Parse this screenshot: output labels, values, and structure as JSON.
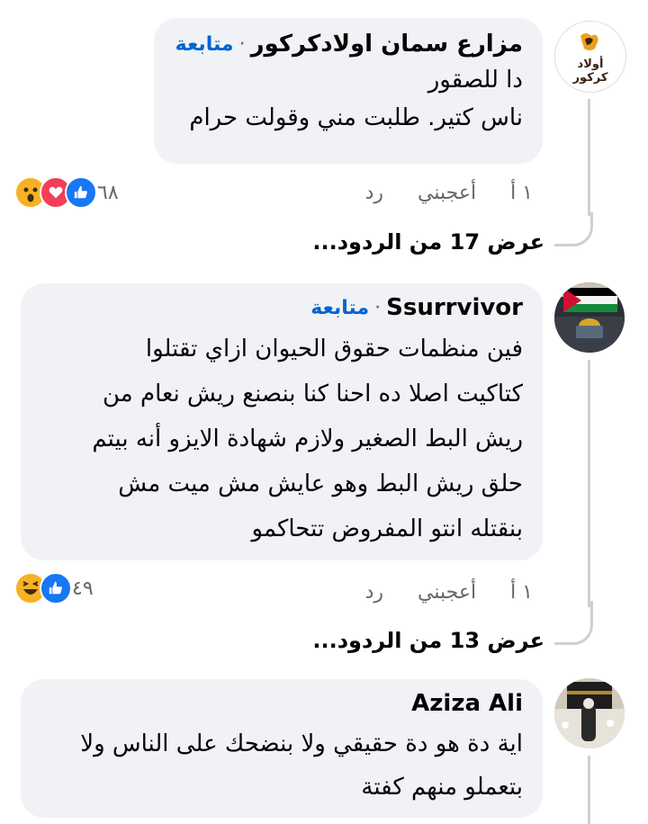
{
  "comments": [
    {
      "author": "مزارع سمان اولادكركور",
      "follow": "متابعة",
      "text": "دا للصقور\nناس كتير. طلبت مني وقولت حرام",
      "time": "١ أ",
      "like": "أعجبني",
      "reply": "رد",
      "reaction_count": "٦٨",
      "reactions": [
        "like-icon",
        "heart-icon",
        "wow-icon"
      ],
      "view_replies": "عرض 17 من الردود...",
      "avatar_text": "أولاد كركور"
    },
    {
      "author": "Ssurrvivor",
      "follow": "متابعة",
      "text": "فين منظمات حقوق الحيوان ازاي تقتلوا\nكتاكيت اصلا ده احنا كنا بنصنع ريش نعام من\nريش البط الصغير ولازم شهادة الايزو أنه بيتم\nحلق ريش البط وهو عايش مش ميت مش\nبنقتله انتو المفروض تتحاكمو",
      "time": "١ أ",
      "like": "أعجبني",
      "reply": "رد",
      "reaction_count": "٤٩",
      "reactions": [
        "like-icon",
        "haha-icon"
      ],
      "view_replies": "عرض 13 من الردود..."
    },
    {
      "author": "Aziza Ali",
      "text": "اية دة هو دة حقيقي ولا بنضحك على الناس ولا\nبتعملو منهم كفتة"
    }
  ],
  "colors": {
    "bubble": "#f0f2f5",
    "follow": "#0064d1",
    "meta": "#65676b",
    "like": "#1877f2",
    "love": "#f33e58",
    "wow": "#f7b125"
  }
}
